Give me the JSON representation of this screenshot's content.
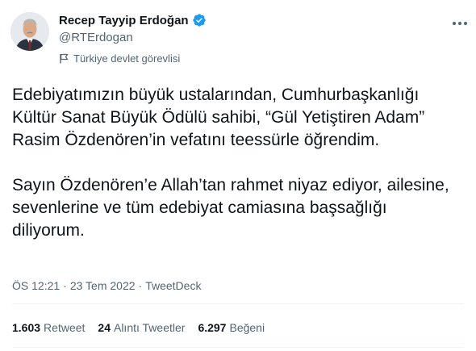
{
  "author": {
    "display_name": "Recep Tayyip Erdoğan",
    "handle": "@RTErdogan",
    "account_label": "Türkiye devlet görevlisi",
    "verified_color": "#1d9bf0"
  },
  "icons": {
    "avatar": "profile-photo",
    "verified": "verified-badge-icon",
    "label": "flag-icon",
    "more": "more-options-icon"
  },
  "tweet": {
    "paragraph_1": "Edebiyatımızın büyük ustalarından, Cumhurbaşkanlığı Kültür Sanat Büyük Ödülü sahibi, “Gül Yetiştiren Adam” Rasim Özdenören’in vefatını teessürle öğrendim.",
    "paragraph_2": "Sayın Özdenören’e Allah’tan rahmet niyaz ediyor, ailesine, sevenlerine ve tüm edebiyat camiasına başsağlığı diliyorum."
  },
  "meta": {
    "time": "ÖS 12:21",
    "separator_1": "·",
    "date": "23 Tem 2022",
    "separator_2": "·",
    "source": "TweetDeck"
  },
  "stats": {
    "retweets_count": "1.603",
    "retweets_label": "Retweet",
    "quotes_count": "24",
    "quotes_label": "Alıntı Tweetler",
    "likes_count": "6.297",
    "likes_label": "Beğeni"
  }
}
